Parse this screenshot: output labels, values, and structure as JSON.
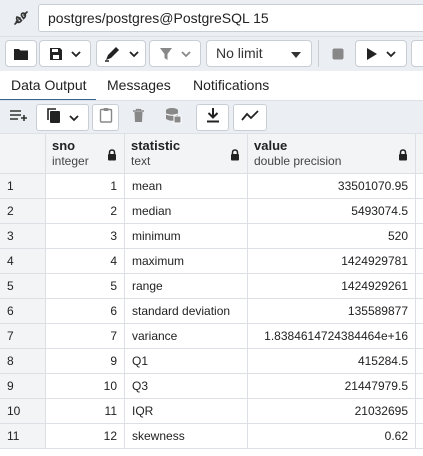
{
  "connection": {
    "label": "postgres/postgres@PostgreSQL 15",
    "icon": "plug-icon"
  },
  "query_toolbar": {
    "limit_value": "No limit",
    "icons": [
      "folder-icon",
      "save-icon",
      "chevron-down-icon",
      "pen-icon",
      "chevron-down-icon",
      "filter-icon",
      "chevron-down-icon",
      "stop-icon",
      "play-icon",
      "chevron-down-icon"
    ]
  },
  "tabs": [
    {
      "label": "Data Output",
      "active": true
    },
    {
      "label": "Messages",
      "active": false
    },
    {
      "label": "Notifications",
      "active": false
    }
  ],
  "result_toolbar": {
    "icons": [
      "add-row-icon",
      "copy-icon",
      "chevron-down-icon",
      "paste-icon",
      "delete-icon",
      "save-data-icon",
      "download-icon",
      "graph-icon"
    ]
  },
  "grid": {
    "columns": [
      {
        "name": "sno",
        "type": "integer",
        "locked": true
      },
      {
        "name": "statistic",
        "type": "text",
        "locked": true
      },
      {
        "name": "value",
        "type": "double precision",
        "locked": true
      }
    ],
    "rows": [
      {
        "index": "1",
        "sno": "1",
        "statistic": "mean",
        "value": "33501070.95"
      },
      {
        "index": "2",
        "sno": "2",
        "statistic": "median",
        "value": "5493074.5"
      },
      {
        "index": "3",
        "sno": "3",
        "statistic": "minimum",
        "value": "520"
      },
      {
        "index": "4",
        "sno": "4",
        "statistic": "maximum",
        "value": "1424929781"
      },
      {
        "index": "5",
        "sno": "5",
        "statistic": "range",
        "value": "1424929261"
      },
      {
        "index": "6",
        "sno": "6",
        "statistic": "standard deviation",
        "value": "135589877"
      },
      {
        "index": "7",
        "sno": "7",
        "statistic": "variance",
        "value": "1.8384614724384464e+16"
      },
      {
        "index": "8",
        "sno": "9",
        "statistic": "Q1",
        "value": "415284.5"
      },
      {
        "index": "9",
        "sno": "10",
        "statistic": "Q3",
        "value": "21447979.5"
      },
      {
        "index": "10",
        "sno": "11",
        "statistic": "IQR",
        "value": "21032695"
      },
      {
        "index": "11",
        "sno": "12",
        "statistic": "skewness",
        "value": "0.62"
      }
    ]
  },
  "colors": {
    "toolbar_bg": "#ebeef3",
    "active_tab": "#326690",
    "border": "#c9ced6"
  }
}
